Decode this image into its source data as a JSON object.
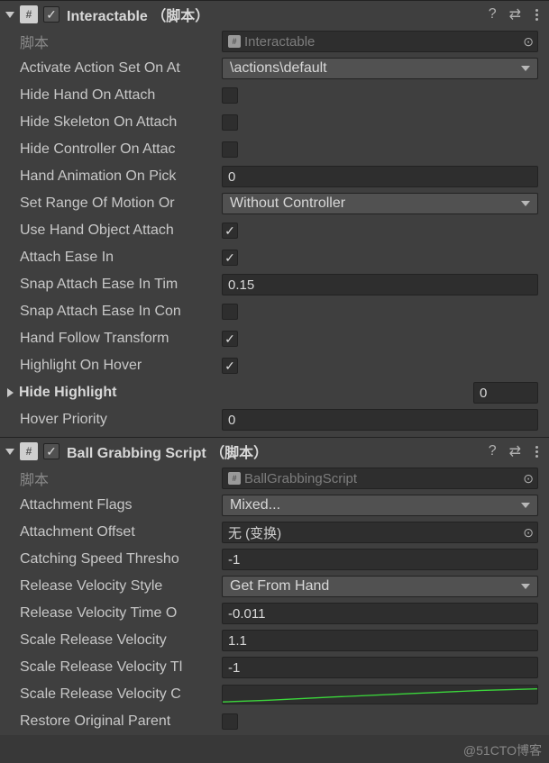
{
  "comp1": {
    "title": "Interactable  （脚本）",
    "scriptLabel": "脚本",
    "scriptName": "Interactable",
    "fields": {
      "activateActionSetOnAttach": {
        "label": "Activate Action Set On At",
        "value": "\\actions\\default"
      },
      "hideHandOnAttach": {
        "label": "Hide Hand On Attach",
        "value": false
      },
      "hideSkeletonOnAttach": {
        "label": "Hide Skeleton On Attach",
        "value": false
      },
      "hideControllerOnAttach": {
        "label": "Hide Controller On Attac",
        "value": false
      },
      "handAnimationOnPick": {
        "label": "Hand Animation On Pick",
        "value": "0"
      },
      "setRangeOfMotion": {
        "label": "Set Range Of Motion Or",
        "value": "Without Controller"
      },
      "useHandObjectAttach": {
        "label": "Use Hand Object Attach",
        "value": true
      },
      "attachEaseIn": {
        "label": "Attach Ease In",
        "value": true
      },
      "snapAttachEaseInTime": {
        "label": "Snap Attach Ease In Tim",
        "value": "0.15"
      },
      "snapAttachEaseInCon": {
        "label": "Snap Attach Ease In Con",
        "value": false
      },
      "handFollowTransform": {
        "label": "Hand Follow Transform",
        "value": true
      },
      "highlightOnHover": {
        "label": "Highlight On Hover",
        "value": true
      },
      "hideHighlight": {
        "label": "Hide Highlight",
        "size": "0"
      },
      "hoverPriority": {
        "label": "Hover Priority",
        "value": "0"
      }
    }
  },
  "comp2": {
    "title": "Ball Grabbing Script  （脚本）",
    "scriptLabel": "脚本",
    "scriptName": "BallGrabbingScript",
    "fields": {
      "attachmentFlags": {
        "label": "Attachment Flags",
        "value": "Mixed..."
      },
      "attachmentOffset": {
        "label": "Attachment Offset",
        "value": "无 (变换)"
      },
      "catchingSpeedThreshold": {
        "label": "Catching Speed Thresho",
        "value": "-1"
      },
      "releaseVelocityStyle": {
        "label": "Release Velocity Style",
        "value": "Get From Hand"
      },
      "releaseVelocityTimeO": {
        "label": "Release Velocity Time O",
        "value": "-0.011"
      },
      "scaleReleaseVelocity": {
        "label": "Scale Release Velocity",
        "value": "1.1"
      },
      "scaleReleaseVelocityT": {
        "label": "Scale Release Velocity Tl",
        "value": "-1"
      },
      "scaleReleaseVelocityC": {
        "label": "Scale Release Velocity C"
      },
      "restoreOriginalParent": {
        "label": "Restore Original Parent",
        "value": false
      }
    }
  },
  "watermark": "@51CTO博客"
}
